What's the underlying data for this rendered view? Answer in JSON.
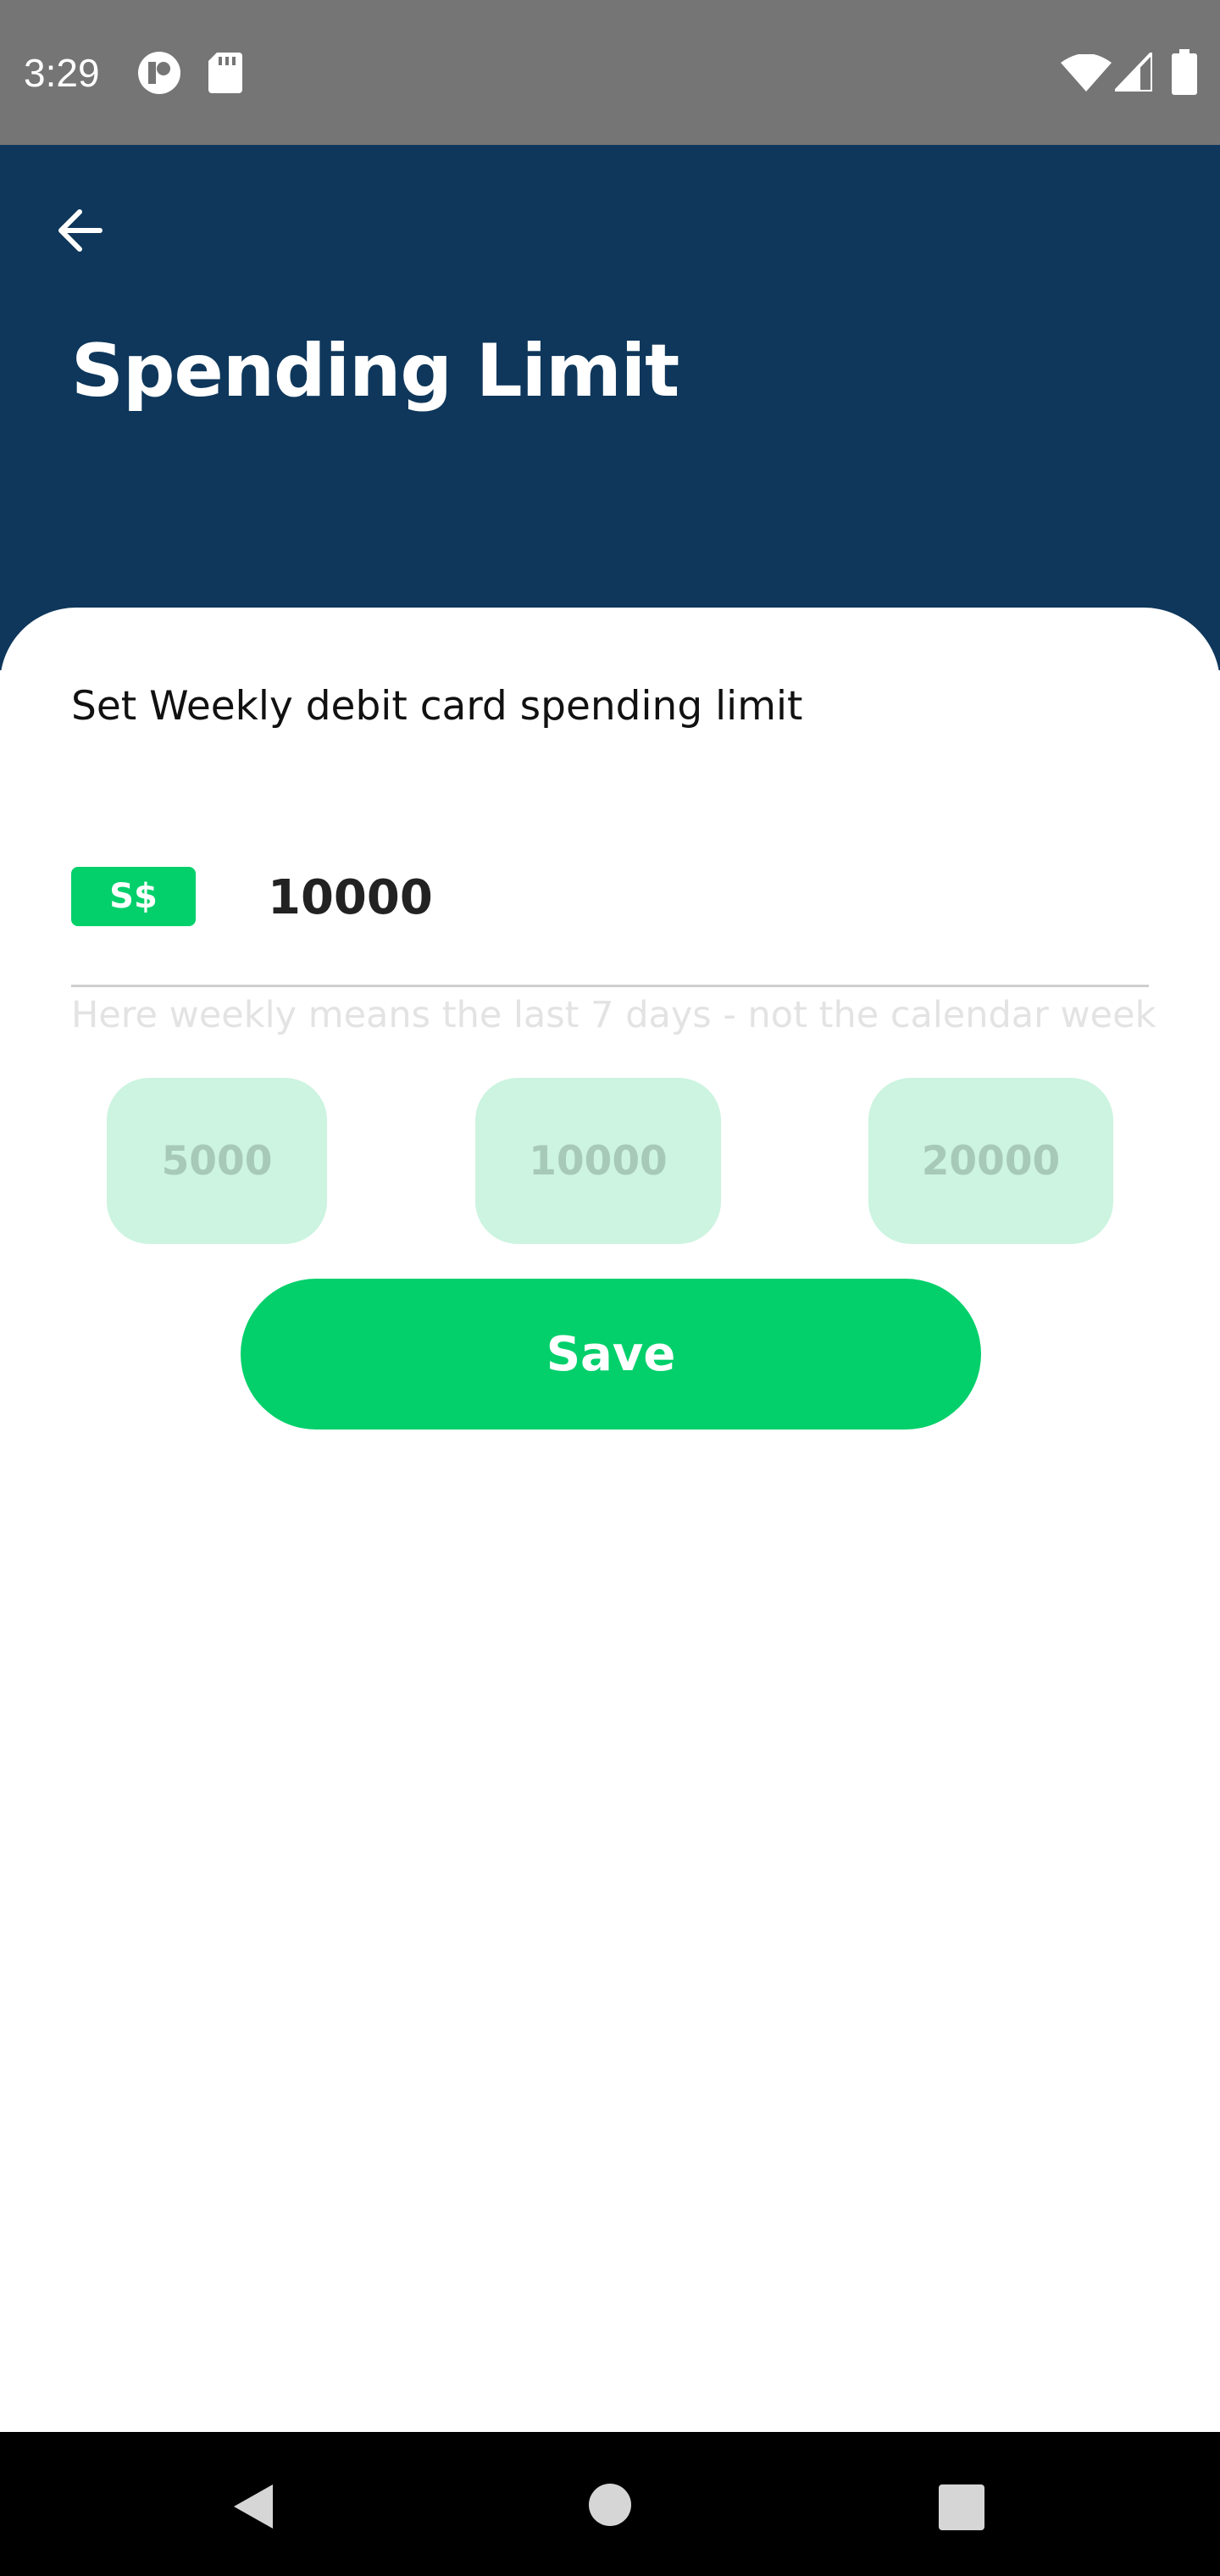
{
  "status_bar": {
    "time": "3:29",
    "left_icons": [
      "app-notification-icon",
      "sd-card-icon"
    ],
    "right_icons": [
      "wifi-icon",
      "cellular-signal-icon",
      "battery-icon"
    ]
  },
  "header": {
    "back_icon": "arrow-left-icon",
    "title": "Spending Limit",
    "background_color": "#0e375b"
  },
  "form": {
    "subtitle": "Set Weekly debit card spending limit",
    "currency": "S$",
    "amount": "10000",
    "helper": "Here weekly means the last 7 days - not the calendar week",
    "presets": [
      "5000",
      "10000",
      "20000"
    ],
    "save_label": "Save",
    "accent_color": "#03d06b",
    "preset_color": "#ccf4e0"
  },
  "nav_bar": {
    "icons": [
      "back-triangle-icon",
      "home-circle-icon",
      "recents-square-icon"
    ]
  }
}
